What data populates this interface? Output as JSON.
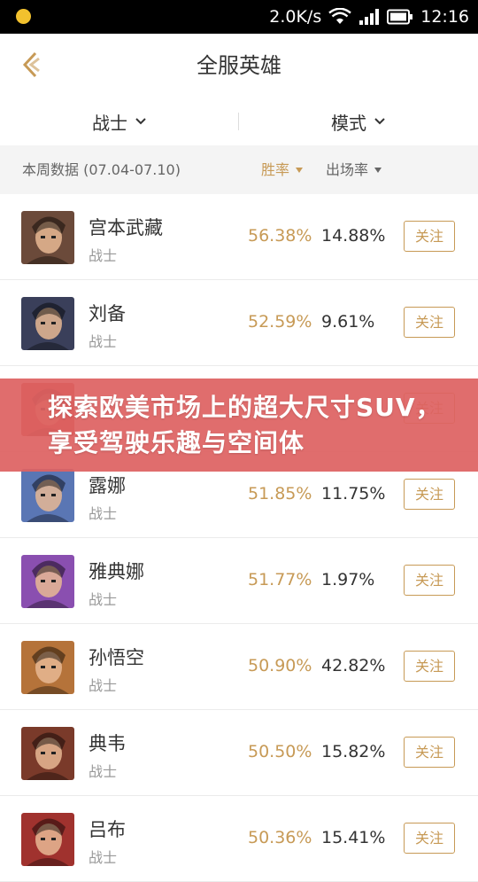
{
  "status_bar": {
    "speed": "2.0K/s",
    "time": "12:16"
  },
  "header": {
    "title": "全服英雄"
  },
  "filters": {
    "role": "战士",
    "mode": "模式"
  },
  "summary": {
    "period": "本周数据 (07.04-07.10)",
    "sort_win": "胜率",
    "sort_pick": "出场率"
  },
  "heroes": [
    {
      "name": "宫本武藏",
      "role": "战士",
      "win_rate": "56.38%",
      "pick_rate": "14.88%",
      "follow": "关注",
      "avatar_color": "#6b4a3a"
    },
    {
      "name": "刘备",
      "role": "战士",
      "win_rate": "52.59%",
      "pick_rate": "9.61%",
      "follow": "关注",
      "avatar_color": "#3a3f5a"
    },
    {
      "name": "露娜",
      "role": "战士",
      "win_rate": "51.85%",
      "pick_rate": "11.75%",
      "follow": "关注",
      "avatar_color": "#5a76b4"
    },
    {
      "name": "雅典娜",
      "role": "战士",
      "win_rate": "51.77%",
      "pick_rate": "1.97%",
      "follow": "关注",
      "avatar_color": "#8a4fb0"
    },
    {
      "name": "孙悟空",
      "role": "战士",
      "win_rate": "50.90%",
      "pick_rate": "42.82%",
      "follow": "关注",
      "avatar_color": "#b5733a"
    },
    {
      "name": "典韦",
      "role": "战士",
      "win_rate": "50.50%",
      "pick_rate": "15.82%",
      "follow": "关注",
      "avatar_color": "#7a3a2a"
    },
    {
      "name": "吕布",
      "role": "战士",
      "win_rate": "50.36%",
      "pick_rate": "15.41%",
      "follow": "关注",
      "avatar_color": "#a0322e"
    }
  ],
  "hidden_row": {
    "follow": "关注",
    "avatar_color": "#c04a3a"
  },
  "banner": {
    "text": "探索欧美市场上的超大尺寸SUV，享受驾驶乐趣与空间体"
  },
  "colors": {
    "accent": "#c79a56",
    "banner": "#de6262"
  }
}
